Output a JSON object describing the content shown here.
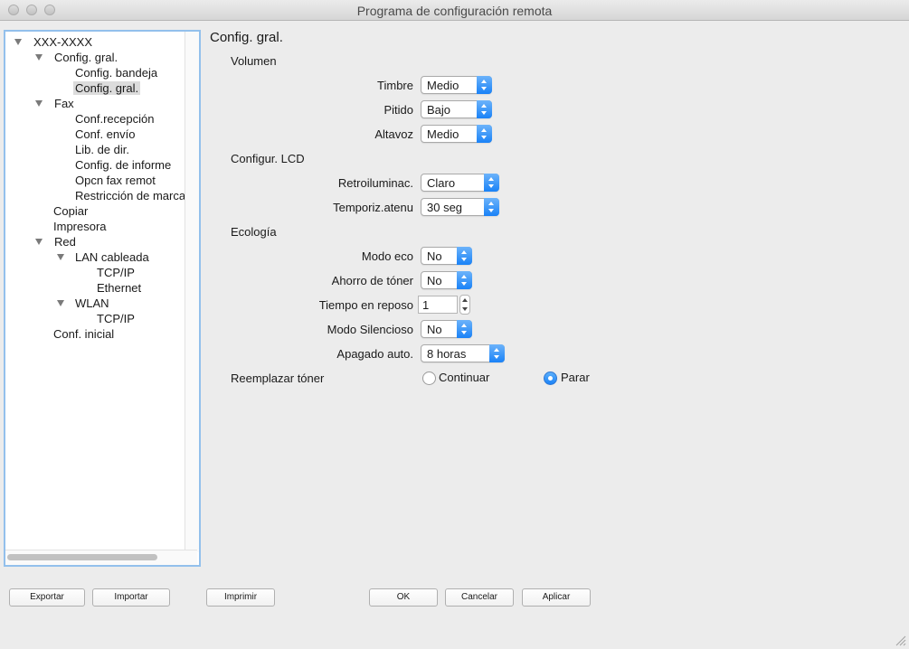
{
  "window": {
    "title": "Programa de configuración remota"
  },
  "tree": {
    "root": "XXX-XXXX",
    "config_gral": "Config. gral.",
    "config_bandeja": "Config. bandeja",
    "config_gral_sub": "Config. gral.",
    "fax": "Fax",
    "conf_recepcion": "Conf.recepción",
    "conf_envio": "Conf. envío",
    "lib_dir": "Lib. de dir.",
    "config_informe": "Config. de informe",
    "opcn_fax_remot": "Opcn fax remot",
    "restriccion": "Restricción de marcación",
    "copiar": "Copiar",
    "impresora": "Impresora",
    "red": "Red",
    "lan_cableada": "LAN cableada",
    "lan_tcpip": "TCP/IP",
    "ethernet": "Ethernet",
    "wlan": "WLAN",
    "wlan_tcpip": "TCP/IP",
    "conf_inicial": "Conf. inicial",
    "selected": "Config. gral."
  },
  "main": {
    "title": "Config. gral.",
    "volumen": {
      "label": "Volumen",
      "timbre_label": "Timbre",
      "timbre_value": "Medio",
      "pitido_label": "Pitido",
      "pitido_value": "Bajo",
      "altavoz_label": "Altavoz",
      "altavoz_value": "Medio"
    },
    "lcd": {
      "label": "Configur. LCD",
      "retro_label": "Retroiluminac.",
      "retro_value": "Claro",
      "temporiz_label": "Temporiz.atenu",
      "temporiz_value": "30 seg"
    },
    "ecologia": {
      "label": "Ecología",
      "modo_eco_label": "Modo eco",
      "modo_eco_value": "No",
      "ahorro_label": "Ahorro de tóner",
      "ahorro_value": "No",
      "reposo_label": "Tiempo en reposo",
      "reposo_value": "1",
      "silencioso_label": "Modo Silencioso",
      "silencioso_value": "No",
      "apagado_label": "Apagado auto.",
      "apagado_value": "8 horas"
    },
    "toner": {
      "label": "Reemplazar tóner",
      "continuar": "Continuar",
      "parar": "Parar",
      "selected": "Parar"
    }
  },
  "buttons": {
    "exportar": "Exportar",
    "importar": "Importar",
    "imprimir": "Imprimir",
    "ok": "OK",
    "cancelar": "Cancelar",
    "aplicar": "Aplicar"
  },
  "colors": {
    "accent": "#1a82f7",
    "selection_border": "#93c0ec",
    "window_bg": "#ececec"
  }
}
